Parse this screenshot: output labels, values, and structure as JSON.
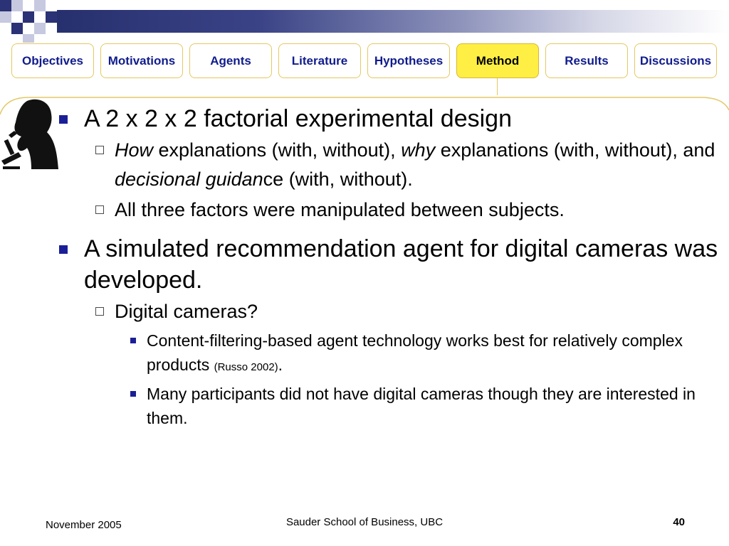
{
  "nav": {
    "tabs": [
      {
        "label": "Objectives",
        "name": "tab-objectives"
      },
      {
        "label": "Motivations",
        "name": "tab-motivations"
      },
      {
        "label": "Agents",
        "name": "tab-agents"
      },
      {
        "label": "Literature",
        "name": "tab-literature"
      },
      {
        "label": "Hypotheses",
        "name": "tab-hypotheses"
      },
      {
        "label": "Method",
        "name": "tab-method",
        "active": true
      },
      {
        "label": "Results",
        "name": "tab-results"
      },
      {
        "label": "Discussions",
        "name": "tab-discussions"
      }
    ]
  },
  "content": {
    "b1": "A 2 x 2 x 2 factorial experimental design",
    "b1_1": {
      "how": "How",
      "t1": " explanations (with, without), ",
      "why": "why",
      "t2": " explanations (with, without), and ",
      "dg": "decisional guidan",
      "t3": "ce (with, without)."
    },
    "b1_2": "All three factors were manipulated between subjects.",
    "b2": "A simulated recommendation agent for digital cameras was developed.",
    "b2_1": "Digital cameras?",
    "b2_1_1": {
      "text": "Content-filtering-based agent technology works best for relatively complex products ",
      "cite": "(Russo 2002)",
      "end": "."
    },
    "b2_1_2": "Many participants did not have digital cameras though they are interested in them."
  },
  "footer": {
    "date": "November 2005",
    "center": "Sauder School of Business, UBC",
    "page": "40"
  },
  "colors": {
    "accent": "#1b1f96",
    "tab_text": "#101c8c",
    "tab_active": "#ffef44",
    "tab_border": "#e6c860"
  },
  "icons": {
    "logo": "decorative-squares",
    "illustration": "scientist-microscope-silhouette"
  }
}
